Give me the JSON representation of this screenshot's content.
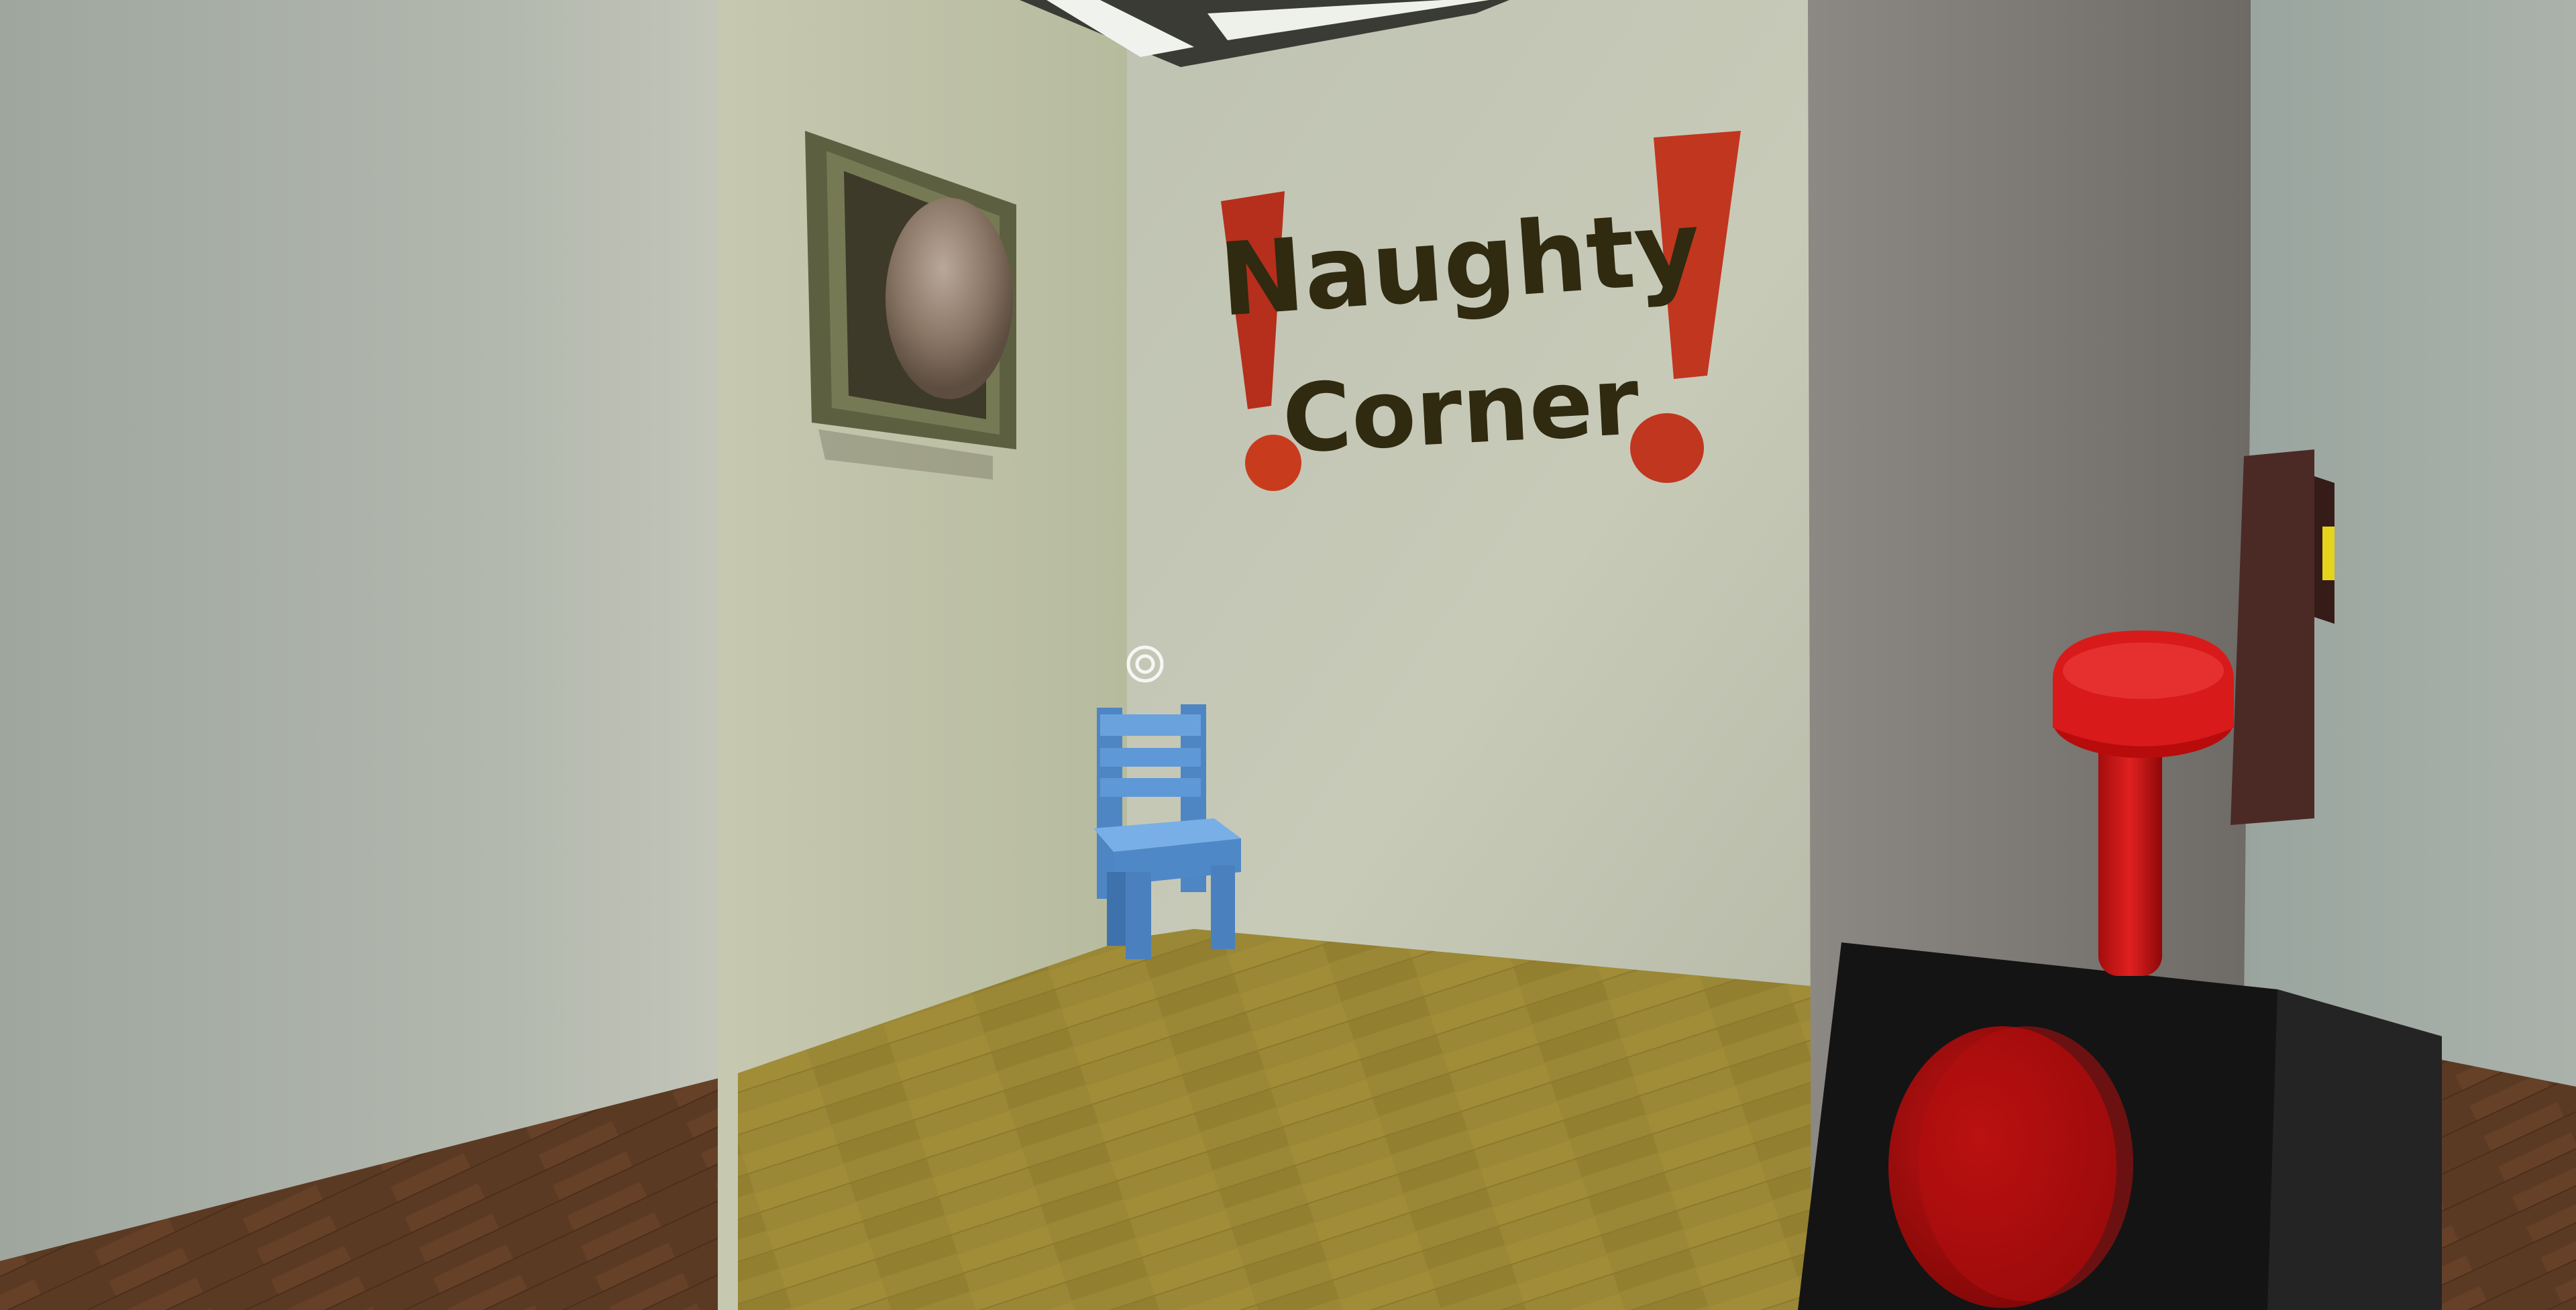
{
  "hud": {
    "crosshair_icon": "crosshair-ring-icon"
  },
  "sign": {
    "line1": "Naughty",
    "line2": "Corner",
    "text_color": "#2f2a10",
    "exclamation_color": "#c1361f"
  },
  "props": {
    "chair_color": "#5b95d2",
    "lever_color": "#cc1111",
    "box_color": "#1a1a1a",
    "indicator_color": "#e6d41c"
  }
}
